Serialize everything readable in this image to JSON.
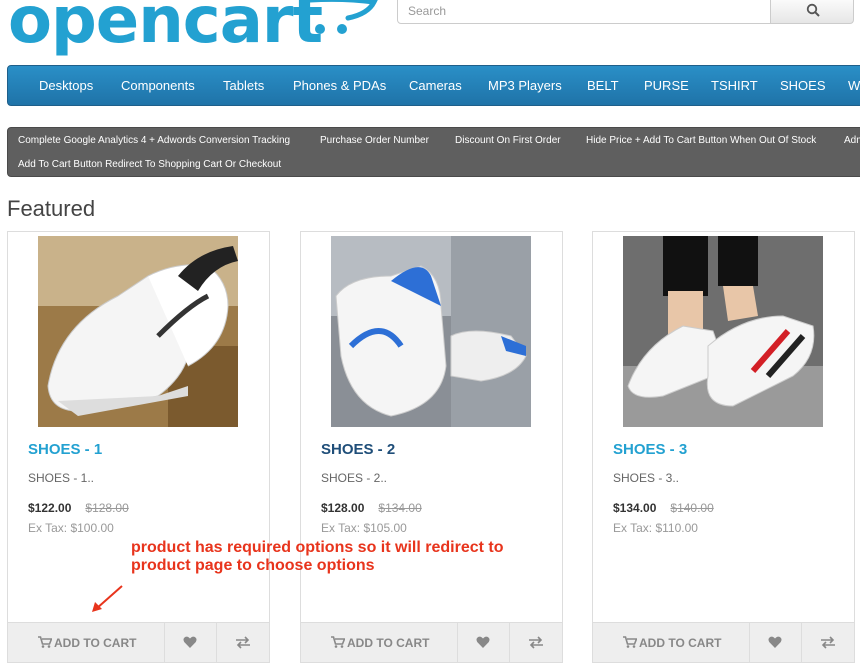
{
  "header": {
    "logo_text": "opencart",
    "search_placeholder": "Search"
  },
  "menu": {
    "items": [
      "Desktops",
      "Components",
      "Tablets",
      "Phones & PDAs",
      "Cameras",
      "MP3 Players",
      "BELT",
      "PURSE",
      "TSHIRT",
      "SHOES",
      "WA"
    ]
  },
  "links": {
    "row1": [
      "Complete Google Analytics 4 + Adwords Conversion Tracking",
      "Purchase Order Number",
      "Discount On First Order",
      "Hide Price + Add To Cart Button When Out Of Stock",
      "Adm"
    ],
    "row2": [
      "Add To Cart Button Redirect To Shopping Cart Or Checkout"
    ]
  },
  "featured": {
    "title": "Featured",
    "products": [
      {
        "name": "SHOES - 1",
        "desc": "SHOES - 1..",
        "price": "$122.00",
        "old_price": "$128.00",
        "tax": "Ex Tax: $100.00"
      },
      {
        "name": "SHOES - 2",
        "desc": "SHOES - 2..",
        "price": "$128.00",
        "old_price": "$134.00",
        "tax": "Ex Tax: $105.00"
      },
      {
        "name": "SHOES - 3",
        "desc": "SHOES - 3..",
        "price": "$134.00",
        "old_price": "$140.00",
        "tax": "Ex Tax: $110.00"
      }
    ],
    "add_to_cart_label": "ADD TO CART"
  },
  "annotation": {
    "line1": "product has required options so it will redirect to",
    "line2": "product page to choose options"
  },
  "colors": {
    "brand": "#23a1d1",
    "menu_bg": "#2a8fc7",
    "annotation": "#e8341c"
  }
}
